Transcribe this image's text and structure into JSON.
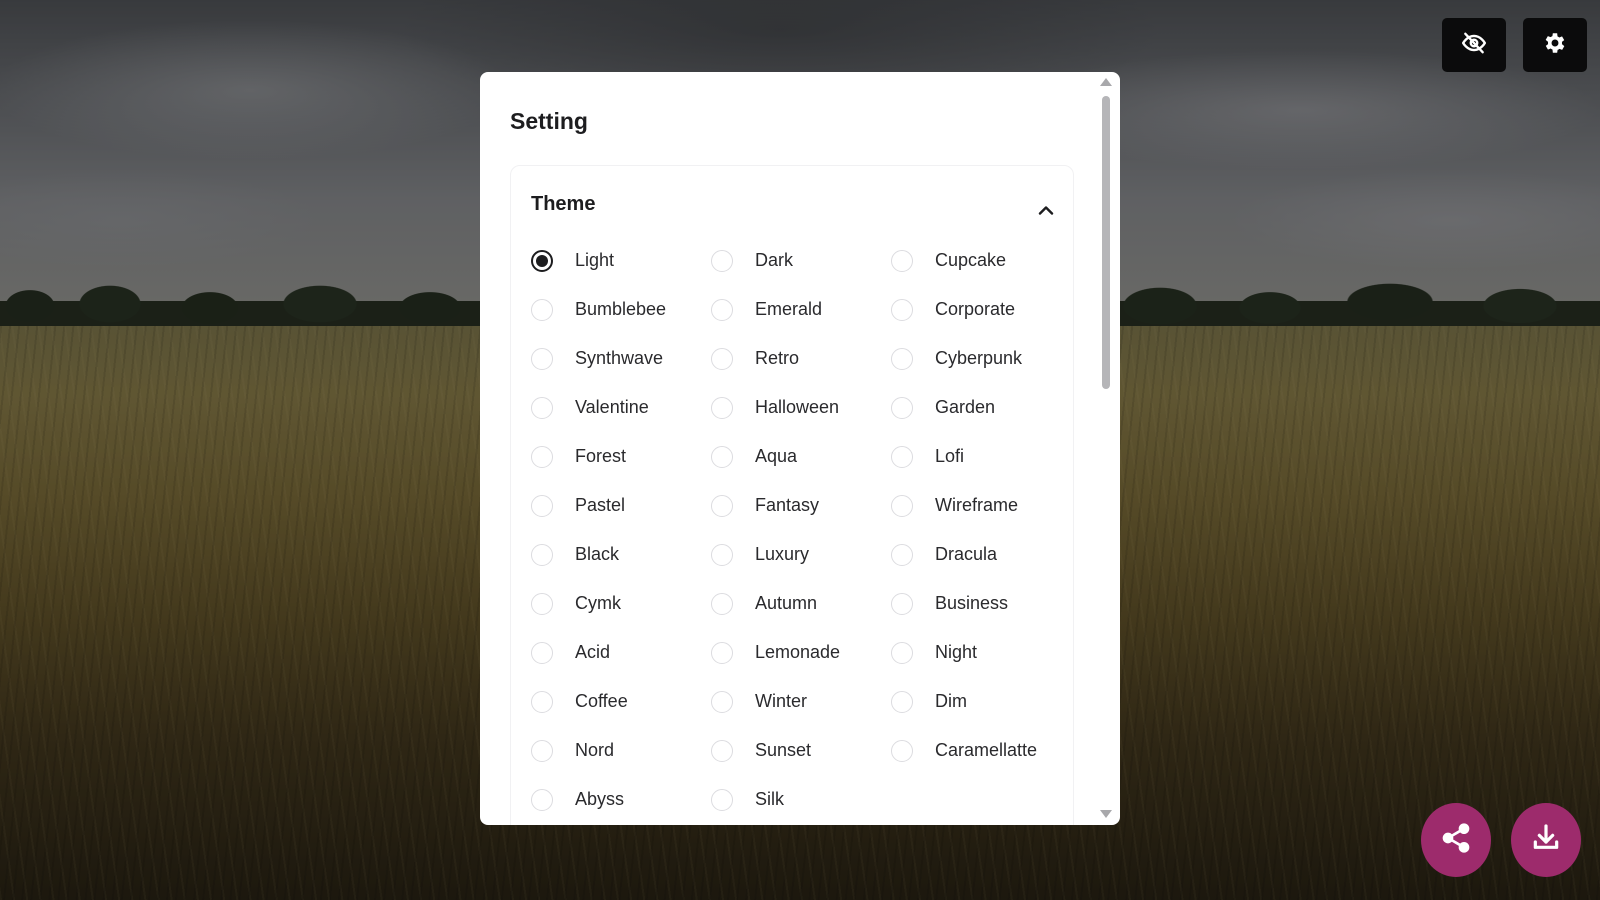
{
  "toolbar": {
    "hide_button_icon": "eye-off-icon",
    "settings_button_icon": "gear-icon"
  },
  "modal": {
    "title": "Setting",
    "theme_section": {
      "title": "Theme",
      "expanded": true,
      "selected": "Light",
      "options": [
        "Light",
        "Dark",
        "Cupcake",
        "Bumblebee",
        "Emerald",
        "Corporate",
        "Synthwave",
        "Retro",
        "Cyberpunk",
        "Valentine",
        "Halloween",
        "Garden",
        "Forest",
        "Aqua",
        "Lofi",
        "Pastel",
        "Fantasy",
        "Wireframe",
        "Black",
        "Luxury",
        "Dracula",
        "Cymk",
        "Autumn",
        "Business",
        "Acid",
        "Lemonade",
        "Night",
        "Coffee",
        "Winter",
        "Dim",
        "Nord",
        "Sunset",
        "Caramellatte",
        "Abyss",
        "Silk"
      ]
    }
  },
  "fabs": {
    "share_icon": "share-icon",
    "download_icon": "download-icon"
  },
  "colors": {
    "fab_background": "#9d2b6c",
    "top_button_background": "#0b0b0c",
    "modal_background": "#ffffff",
    "text_primary": "#1d1d1f"
  }
}
